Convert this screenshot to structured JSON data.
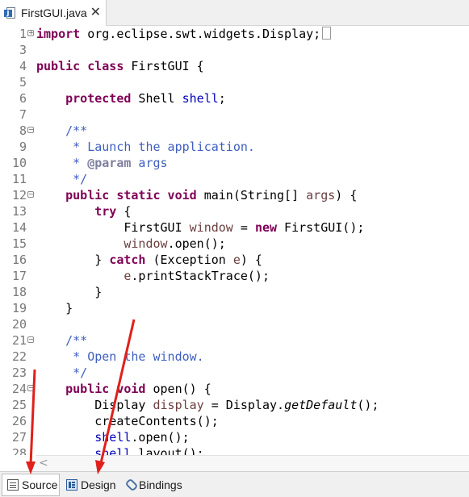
{
  "editor_tab": {
    "title": "FirstGUI.java",
    "close": "✕"
  },
  "lines": [
    {
      "n": "1",
      "fold": "+"
    },
    {
      "n": "3"
    },
    {
      "n": "4"
    },
    {
      "n": "5"
    },
    {
      "n": "6"
    },
    {
      "n": "7"
    },
    {
      "n": "8",
      "fold": "−"
    },
    {
      "n": "9"
    },
    {
      "n": "10"
    },
    {
      "n": "11"
    },
    {
      "n": "12",
      "fold": "−"
    },
    {
      "n": "13"
    },
    {
      "n": "14"
    },
    {
      "n": "15"
    },
    {
      "n": "16"
    },
    {
      "n": "17"
    },
    {
      "n": "18"
    },
    {
      "n": "19"
    },
    {
      "n": "20"
    },
    {
      "n": "21",
      "fold": "−"
    },
    {
      "n": "22"
    },
    {
      "n": "23"
    },
    {
      "n": "24",
      "fold": "−"
    },
    {
      "n": "25"
    },
    {
      "n": "26"
    },
    {
      "n": "27"
    },
    {
      "n": "28"
    }
  ],
  "code": {
    "l1_kw": "import",
    "l1_rest": " org.eclipse.swt.widgets.Display;",
    "l4_kw": "public class",
    "l4_rest": " FirstGUI {",
    "l6_kw": "protected",
    "l6_type": " Shell ",
    "l6_field": "shell",
    "l6_end": ";",
    "l8": "/**",
    "l9": " * Launch the application.",
    "l10_pre": " * ",
    "l10_tag": "@param",
    "l10_post": " args",
    "l11": " */",
    "l12_kw": "public static void",
    "l12_rest": " main(String[] ",
    "l12_arg": "args",
    "l12_end": ") {",
    "l13_kw": "try",
    "l13_rest": " {",
    "l14_type": "FirstGUI ",
    "l14_var": "window",
    "l14_mid": " = ",
    "l14_kw": "new",
    "l14_end": " FirstGUI();",
    "l15_var": "window",
    "l15_end": ".open();",
    "l16_pre": "} ",
    "l16_kw": "catch",
    "l16_mid": " (Exception ",
    "l16_var": "e",
    "l16_end": ") {",
    "l17_var": "e",
    "l17_end": ".printStackTrace();",
    "l18": "}",
    "l19": "}",
    "l21": "/**",
    "l22": " * Open the window.",
    "l23": " */",
    "l24_kw": "public void",
    "l24_rest": " open() {",
    "l25_type": "Display ",
    "l25_var": "display",
    "l25_mid": " = Display.",
    "l25_it": "getDefault",
    "l25_end": "();",
    "l26": "createContents();",
    "l27_f": "shell",
    "l27_end": ".open();",
    "l28_f": "shell",
    "l28_end": ".layout();"
  },
  "bottom_tabs": {
    "source": "Source",
    "design": "Design",
    "bindings": "Bindings"
  },
  "scroll_left": "<",
  "colors": {
    "keyword": "#7f0055",
    "field": "#0000c0",
    "comment": "#3f5fbf",
    "annotation_arrow": "#e0201b"
  }
}
